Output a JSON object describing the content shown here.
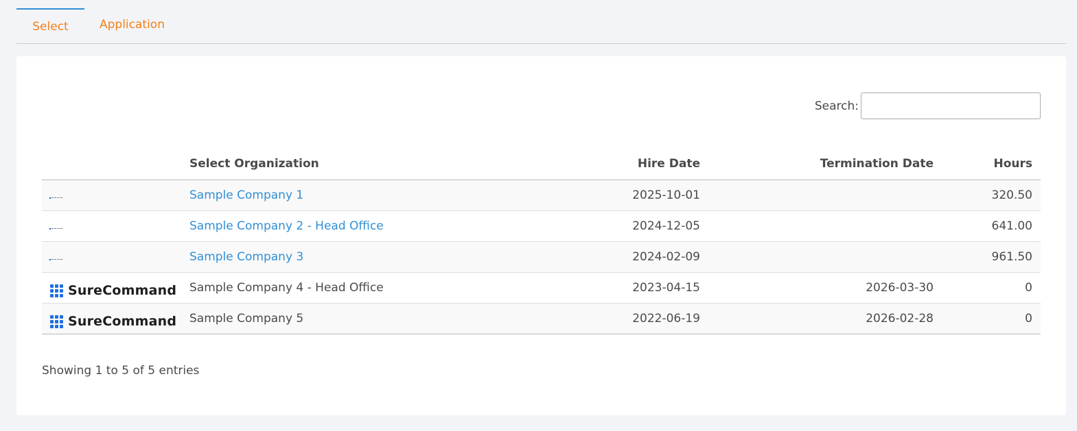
{
  "tabs": {
    "select_label": "Select",
    "application_label": "Application"
  },
  "search": {
    "label": "Search:",
    "value": ""
  },
  "table": {
    "headers": {
      "logo": "",
      "organization": "Select Organization",
      "hire_date": "Hire Date",
      "termination_date": "Termination Date",
      "hours": "Hours"
    },
    "rows": [
      {
        "logo": "small-logo",
        "organization": "Sample Company 1",
        "is_link": true,
        "hire_date": "2025-10-01",
        "termination_date": "",
        "hours": "320.50"
      },
      {
        "logo": "small-logo",
        "organization": "Sample Company 2 - Head Office",
        "is_link": true,
        "hire_date": "2024-12-05",
        "termination_date": "",
        "hours": "641.00"
      },
      {
        "logo": "small-logo",
        "organization": "Sample Company 3",
        "is_link": true,
        "hire_date": "2024-02-09",
        "termination_date": "",
        "hours": "961.50"
      },
      {
        "logo": "surecommand-logo",
        "logo_text": "SureCommand",
        "organization": "Sample Company 4 - Head Office",
        "is_link": false,
        "hire_date": "2023-04-15",
        "termination_date": "2026-03-30",
        "hours": "0"
      },
      {
        "logo": "surecommand-logo",
        "logo_text": "SureCommand",
        "organization": "Sample Company 5",
        "is_link": false,
        "hire_date": "2022-06-19",
        "termination_date": "2026-02-28",
        "hours": "0"
      }
    ]
  },
  "footer": {
    "info": "Showing 1 to 5 of 5 entries"
  },
  "colors": {
    "accent_orange": "#f0811a",
    "link_blue": "#2f8fd6",
    "logo_blue": "#1f6fe0"
  }
}
